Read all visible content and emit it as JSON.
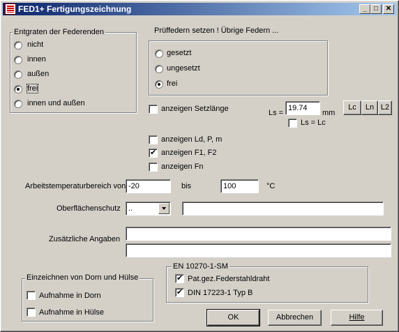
{
  "window": {
    "title": "FED1+ Fertigungszeichnung",
    "min_label": "_",
    "max_label": "□",
    "close_label": "✕"
  },
  "entgraten": {
    "group_label": "Entgraten der Federenden",
    "options": [
      "nicht",
      "innen",
      "außen",
      "frei",
      "innen und außen"
    ],
    "selected": "frei"
  },
  "pruef": {
    "header": "Prüffedern setzen !  Übrige Federn ...",
    "options": [
      "gesetzt",
      "ungesetzt",
      "frei"
    ],
    "selected": "frei"
  },
  "setzlaenge": {
    "label": "anzeigen Setzlänge",
    "checked": false,
    "ls_label": "Ls =",
    "ls_value": "19.74",
    "unit": "mm",
    "ls_eq_lc_label": "Ls = Lc",
    "ls_eq_lc_checked": false
  },
  "length_buttons": [
    "Lc",
    "Ln",
    "L2"
  ],
  "display_options": [
    {
      "label": "anzeigen Ld, P, m",
      "checked": false
    },
    {
      "label": "anzeigen F1, F2",
      "checked": true
    },
    {
      "label": "anzeigen Fn",
      "checked": false
    }
  ],
  "temperature": {
    "label": "Arbeitstemperaturbereich von",
    "from": "-20",
    "to_label": "bis",
    "to": "100",
    "unit": "°C"
  },
  "surface": {
    "label": "Oberflächenschutz",
    "selected": "..",
    "text": ""
  },
  "additional": {
    "label": "Zusätzliche Angaben",
    "line1": "",
    "line2": ""
  },
  "einzeichnen": {
    "group_label": "Einzeichnen von Dorn und Hülse",
    "items": [
      {
        "label": "Aufnahme in Dorn",
        "checked": false
      },
      {
        "label": "Aufnahme in Hülse",
        "checked": false
      }
    ]
  },
  "norm": {
    "group_label": "EN 10270-1-SM",
    "items": [
      {
        "label": "Pat.gez.Federstahldraht",
        "checked": true
      },
      {
        "label": "DIN 17223-1 Typ B",
        "checked": true
      }
    ]
  },
  "buttons": {
    "ok": "OK",
    "cancel": "Abbrechen",
    "help": "Hilfe"
  }
}
